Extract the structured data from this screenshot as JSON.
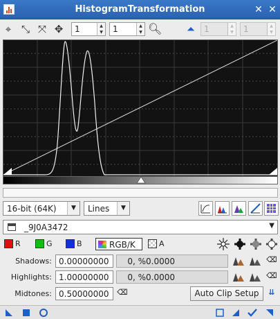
{
  "window": {
    "title": "HistogramTransformation",
    "pin_icon": "pin-icon",
    "close_icon": "close-icon"
  },
  "toolbar": {
    "zoom_h": "1",
    "zoom_v": "1",
    "disabled_h": "1",
    "disabled_v": "1"
  },
  "format": {
    "bit_depth": "16-bit (64K)",
    "graph_style": "Lines"
  },
  "view": {
    "selected": "_9J0A3472"
  },
  "channels": {
    "r": "R",
    "g": "G",
    "b": "B",
    "rgbk": "RGB/K",
    "a": "A",
    "colors": {
      "r": "#e01010",
      "g": "#10c010",
      "b": "#1030e0"
    }
  },
  "params": {
    "shadows_label": "Shadows:",
    "shadows_value": "0.00000000",
    "shadows_readout": "0, %0.0000",
    "highlights_label": "Highlights:",
    "highlights_value": "1.00000000",
    "highlights_readout": "0, %0.0000",
    "midtones_label": "Midtones:",
    "midtones_value": "0.50000000"
  },
  "buttons": {
    "auto_clip_setup": "Auto Clip Setup"
  }
}
